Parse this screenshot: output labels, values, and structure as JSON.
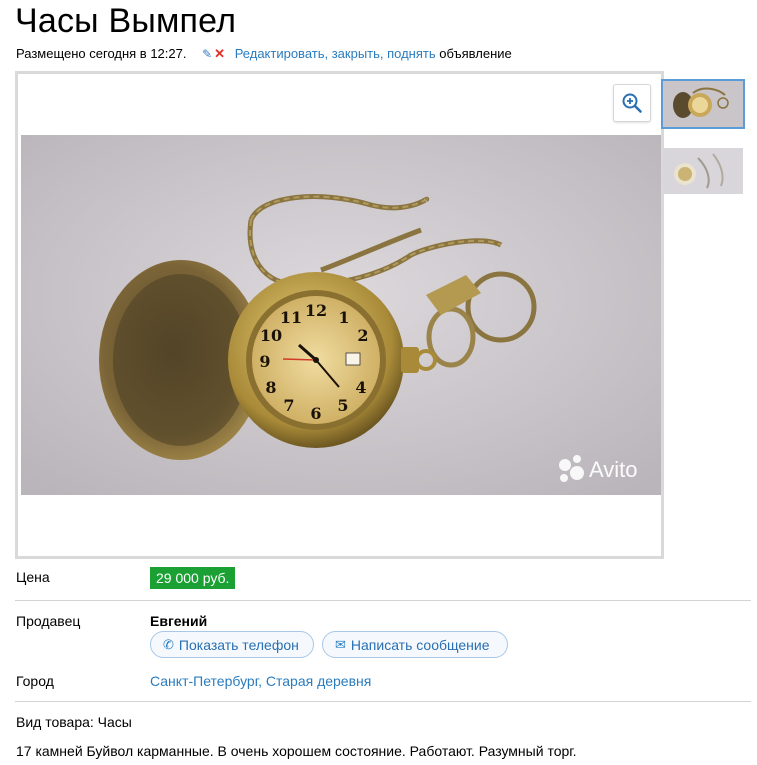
{
  "listing": {
    "title": "Часы Вымпел",
    "posted": "Размещено сегодня в 12:27.",
    "actions_links": "Редактировать, закрыть, поднять",
    "actions_suffix": "объявление"
  },
  "gallery": {
    "watermark": "Avito",
    "zoom_icon": "zoom-in-icon",
    "thumbnails": [
      "thumb-1",
      "thumb-2"
    ]
  },
  "details": {
    "price_label": "Цена",
    "price": "29 000 руб.",
    "seller_label": "Продавец",
    "seller_name": "Евгений",
    "show_phone": "Показать телефон",
    "send_message": "Написать сообщение",
    "city_label": "Город",
    "city": "Санкт-Петербург",
    "district": "Старая деревня",
    "item_type": "Вид товара: Часы",
    "description": "17 камней Буйвол карманные. В очень хорошем состояние. Работают. Разумный торг."
  },
  "colors": {
    "price_bg": "#1aa033",
    "link": "#2a7cbf",
    "accent_border": "#5b9bd8"
  }
}
